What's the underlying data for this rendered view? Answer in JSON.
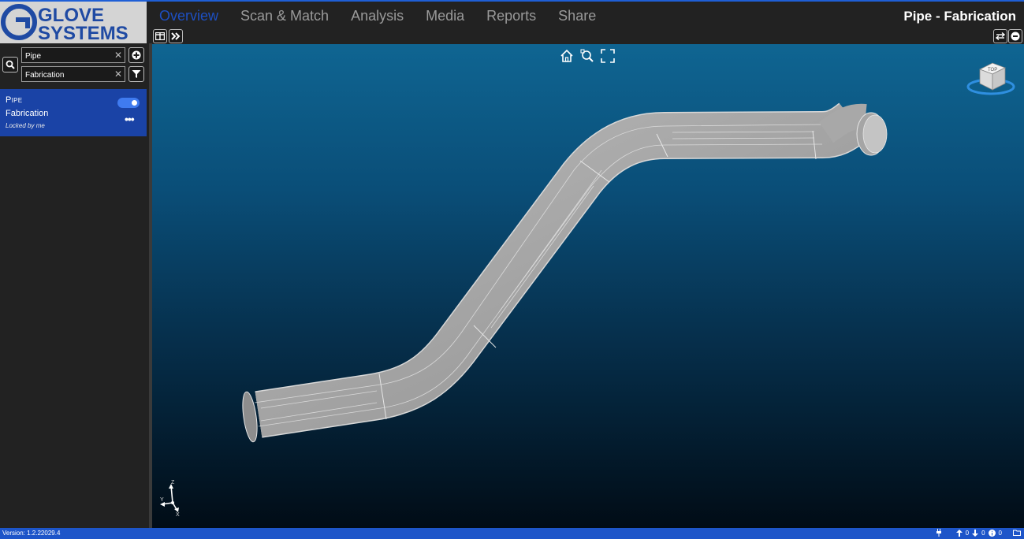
{
  "logo": {
    "line1": "GLOVE",
    "line2": "SYSTEMS"
  },
  "nav": {
    "tabs": [
      {
        "label": "Overview",
        "active": true
      },
      {
        "label": "Scan & Match",
        "active": false
      },
      {
        "label": "Analysis",
        "active": false
      },
      {
        "label": "Media",
        "active": false
      },
      {
        "label": "Reports",
        "active": false
      },
      {
        "label": "Share",
        "active": false
      }
    ],
    "page_title": "Pipe - Fabrication"
  },
  "sidebar": {
    "search_value": "Pipe",
    "filter_value": "Fabrication",
    "items": [
      {
        "name": "Pipe",
        "subtitle": "Fabrication",
        "status": "Locked by me",
        "enabled": true
      }
    ]
  },
  "viewport": {
    "navcube_label": "TOP",
    "axis_labels": {
      "z": "Z",
      "y": "Y",
      "x": "X"
    }
  },
  "status": {
    "version": "Version: 1.2.22029.4",
    "uploads": "0",
    "downloads": "0",
    "info": "0"
  },
  "colors": {
    "accent": "#1d4fc2",
    "selected_item": "#1a43a6",
    "status_bar": "#1d55c9"
  }
}
